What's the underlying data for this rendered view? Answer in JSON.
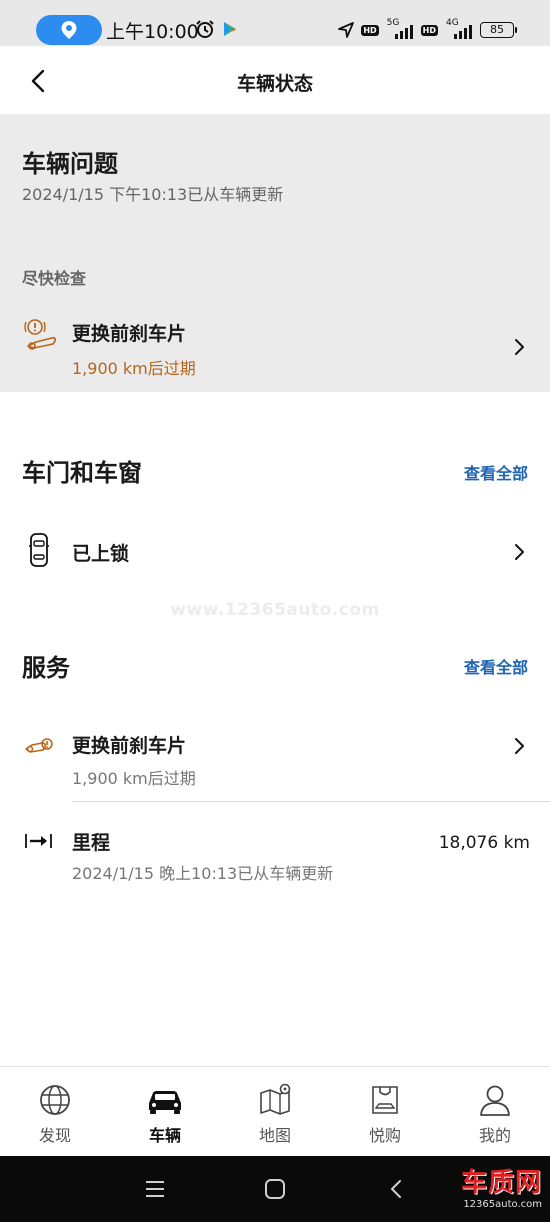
{
  "status_bar": {
    "time": "上午10:00",
    "network_1": "5G",
    "network_2": "4G",
    "hd_1": "HD",
    "hd_2": "HD",
    "battery": "85"
  },
  "header": {
    "title": "车辆状态"
  },
  "vehicle_issues": {
    "title": "车辆问题",
    "updated": "2024/1/15 下午10:13已从车辆更新",
    "urgency_label": "尽快检查",
    "item": {
      "title": "更换前刹车片",
      "subtitle": "1,900 km后过期"
    }
  },
  "doors_windows": {
    "title": "车门和车窗",
    "see_all": "查看全部",
    "item": {
      "title": "已上锁"
    }
  },
  "watermark": "www.12365auto.com",
  "service": {
    "title": "服务",
    "see_all": "查看全部",
    "items": [
      {
        "title": "更换前刹车片",
        "subtitle": "1,900 km后过期"
      },
      {
        "title": "里程",
        "subtitle": "2024/1/15 晚上10:13已从车辆更新",
        "value": "18,076 km"
      }
    ]
  },
  "tabs": [
    {
      "label": "发现",
      "icon": "globe-icon",
      "active": false
    },
    {
      "label": "车辆",
      "icon": "car-icon",
      "active": true
    },
    {
      "label": "地图",
      "icon": "map-icon",
      "active": false
    },
    {
      "label": "悦购",
      "icon": "shopping-bag-icon",
      "active": false
    },
    {
      "label": "我的",
      "icon": "person-icon",
      "active": false
    }
  ],
  "brand_logo": {
    "name": "车质网",
    "url": "12365auto.com"
  },
  "colors": {
    "accent_link": "#1f63b3",
    "warning": "#b8651b",
    "panel_bg": "#ebebeb"
  }
}
